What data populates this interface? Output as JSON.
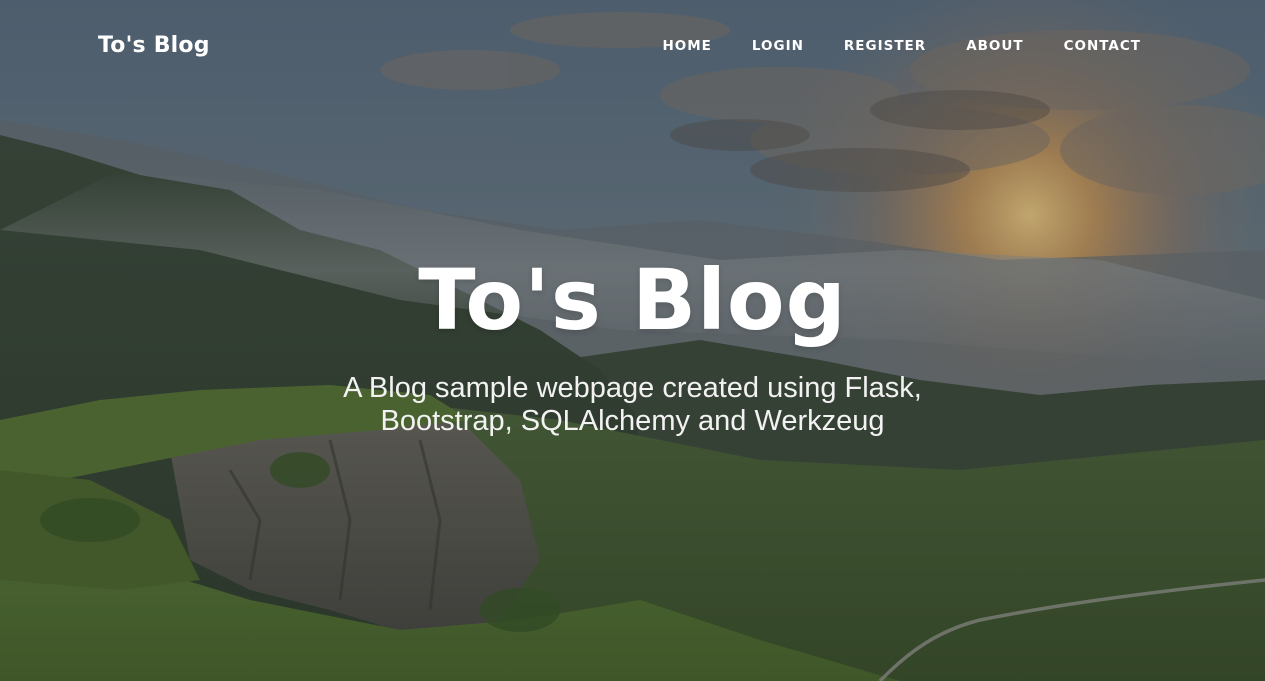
{
  "navbar": {
    "brand": "To's Blog",
    "links": [
      "HOME",
      "LOGIN",
      "REGISTER",
      "ABOUT",
      "CONTACT"
    ]
  },
  "hero": {
    "title": "To's Blog",
    "subtitle": "A Blog sample webpage created using Flask, Bootstrap, SQLAlchemy and Werkzeug"
  },
  "colors": {
    "text": "#ffffff",
    "overlay": "#212529"
  }
}
